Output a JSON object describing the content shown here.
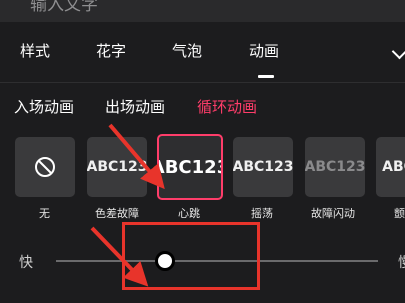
{
  "text_input": {
    "placeholder": "输入文字"
  },
  "tabs": [
    {
      "label": "样式"
    },
    {
      "label": "花字"
    },
    {
      "label": "气泡"
    },
    {
      "label": "动画",
      "active": true
    }
  ],
  "subtabs": [
    {
      "label": "入场动画"
    },
    {
      "label": "出场动画"
    },
    {
      "label": "循环动画",
      "active": true
    }
  ],
  "animations": [
    {
      "label": "无",
      "icon": "no-symbol-icon"
    },
    {
      "label": "色差故障",
      "sample": "ABC123"
    },
    {
      "label": "心跳",
      "sample": "ABC123",
      "selected": true
    },
    {
      "label": "摇荡",
      "sample": "ABC123"
    },
    {
      "label": "故障闪动",
      "sample": "ABC123"
    },
    {
      "label": "颤",
      "sample": "ABC"
    }
  ],
  "speed": {
    "fast_label": "快",
    "slow_label": "慢",
    "value_fraction": 0.34
  },
  "colors": {
    "accent": "#ff3d6a",
    "annotation": "#e8342b",
    "background": "#1c1c1e"
  }
}
